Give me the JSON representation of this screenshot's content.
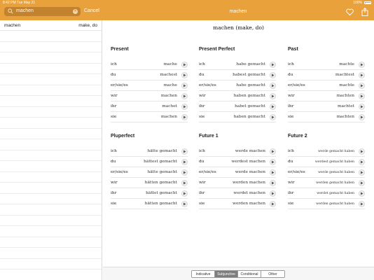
{
  "status_bar": {
    "time_date": "8:42 PM  Tue May 21",
    "battery_label": "100%"
  },
  "header": {
    "title": "machen",
    "search_query": "machen",
    "cancel_label": "Cancel",
    "accent_color": "#e9a23b"
  },
  "sidebar": {
    "results": [
      {
        "word": "machen",
        "translation": "make, do"
      }
    ]
  },
  "main": {
    "verb_title": "machen (make, do)"
  },
  "tenses": [
    {
      "name": "Present",
      "rows": [
        {
          "pronoun": "ich",
          "form": "mache"
        },
        {
          "pronoun": "du",
          "form": "machest"
        },
        {
          "pronoun": "er/sie/es",
          "form": "mache"
        },
        {
          "pronoun": "wir",
          "form": "machen"
        },
        {
          "pronoun": "ihr",
          "form": "machet"
        },
        {
          "pronoun": "sie",
          "form": "machen"
        }
      ]
    },
    {
      "name": "Present Perfect",
      "rows": [
        {
          "pronoun": "ich",
          "form": "habe gemacht"
        },
        {
          "pronoun": "du",
          "form": "habest gemacht"
        },
        {
          "pronoun": "er/sie/es",
          "form": "habe gemacht"
        },
        {
          "pronoun": "wir",
          "form": "haben gemacht"
        },
        {
          "pronoun": "ihr",
          "form": "habet gemacht"
        },
        {
          "pronoun": "sie",
          "form": "haben gemacht"
        }
      ]
    },
    {
      "name": "Past",
      "rows": [
        {
          "pronoun": "ich",
          "form": "machte"
        },
        {
          "pronoun": "du",
          "form": "machtest"
        },
        {
          "pronoun": "er/sie/es",
          "form": "machte"
        },
        {
          "pronoun": "wir",
          "form": "machten"
        },
        {
          "pronoun": "ihr",
          "form": "machtet"
        },
        {
          "pronoun": "sie",
          "form": "machten"
        }
      ]
    },
    {
      "name": "Pluperfect",
      "rows": [
        {
          "pronoun": "ich",
          "form": "hätte gemacht"
        },
        {
          "pronoun": "du",
          "form": "hättest gemacht"
        },
        {
          "pronoun": "er/sie/es",
          "form": "hätte gemacht"
        },
        {
          "pronoun": "wir",
          "form": "hätten gemacht"
        },
        {
          "pronoun": "ihr",
          "form": "hättet gemacht"
        },
        {
          "pronoun": "sie",
          "form": "hätten gemacht"
        }
      ]
    },
    {
      "name": "Future 1",
      "rows": [
        {
          "pronoun": "ich",
          "form": "werde machen"
        },
        {
          "pronoun": "du",
          "form": "werdest machen"
        },
        {
          "pronoun": "er/sie/es",
          "form": "werde machen"
        },
        {
          "pronoun": "wir",
          "form": "werden machen"
        },
        {
          "pronoun": "ihr",
          "form": "werdet machen"
        },
        {
          "pronoun": "sie",
          "form": "werden machen"
        }
      ]
    },
    {
      "name": "Future 2",
      "rows": [
        {
          "pronoun": "ich",
          "form": "werde gemacht haben"
        },
        {
          "pronoun": "du",
          "form": "werdest gemacht haben"
        },
        {
          "pronoun": "er/sie/es",
          "form": "werde gemacht haben"
        },
        {
          "pronoun": "wir",
          "form": "werden gemacht haben"
        },
        {
          "pronoun": "ihr",
          "form": "werdet gemacht haben"
        },
        {
          "pronoun": "sie",
          "form": "werden gemacht haben"
        }
      ]
    }
  ],
  "mood_tabs": {
    "items": [
      "Indicative",
      "Subjunctive",
      "Conditional",
      "Other"
    ],
    "selected": "Subjunctive"
  }
}
